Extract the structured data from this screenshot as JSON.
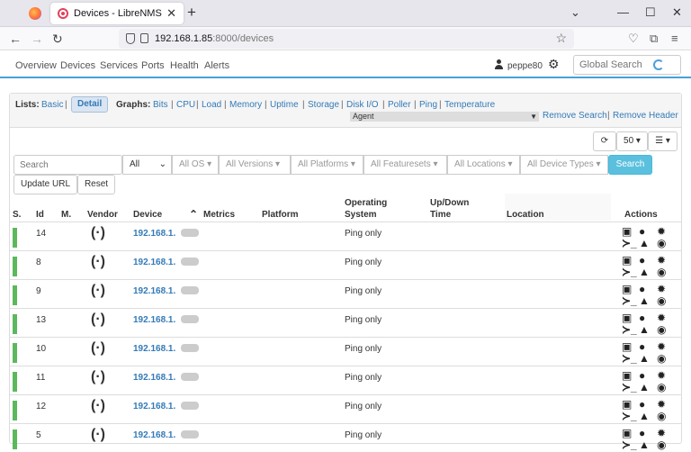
{
  "browser": {
    "tab_title": "Devices - LibreNMS",
    "url_host": "192.168.1.85",
    "url_path": ":8000/devices"
  },
  "nav": {
    "menu": [
      "Overview",
      "Devices",
      "Services",
      "Ports",
      "Health",
      "Alerts"
    ],
    "username": "peppe80",
    "global_search_placeholder": "Global Search"
  },
  "lists": {
    "label": "Lists:",
    "basic": "Basic",
    "detail": "Detail",
    "graphs_label": "Graphs:",
    "graphs": [
      "Bits",
      "CPU",
      "Load",
      "Memory",
      "Uptime",
      "Storage",
      "Disk I/O",
      "Poller",
      "Ping",
      "Temperature"
    ],
    "agent": "Agent",
    "remove_search": "Remove Search",
    "remove_header": "Remove Header"
  },
  "toolbar": {
    "per_page": "50",
    "search_placeholder": "Search",
    "all": "All",
    "filters": [
      "All OS",
      "All Versions",
      "All Platforms",
      "All Featuresets",
      "All Locations",
      "All Device Types"
    ],
    "search_btn": "Search",
    "update_url": "Update URL",
    "reset": "Reset"
  },
  "table": {
    "headers": {
      "s": "S.",
      "id": "Id",
      "m": "M.",
      "vendor": "Vendor",
      "device": "Device",
      "metrics": "Metrics",
      "platform": "Platform",
      "os_line1": "Operating",
      "os_line2": "System",
      "uptime_line1": "Up/Down",
      "uptime_line2": "Time",
      "location": "Location",
      "actions": "Actions"
    },
    "rows": [
      {
        "id": "14",
        "device": "192.168.1.",
        "os": "Ping only"
      },
      {
        "id": "8",
        "device": "192.168.1.",
        "os": "Ping only"
      },
      {
        "id": "9",
        "device": "192.168.1.",
        "os": "Ping only"
      },
      {
        "id": "13",
        "device": "192.168.1.",
        "os": "Ping only"
      },
      {
        "id": "10",
        "device": "192.168.1.",
        "os": "Ping only"
      },
      {
        "id": "11",
        "device": "192.168.1.",
        "os": "Ping only"
      },
      {
        "id": "12",
        "device": "192.168.1.",
        "os": "Ping only"
      },
      {
        "id": "5",
        "device": "192.168.1.",
        "os": "Ping only"
      }
    ]
  },
  "colors": {
    "accent": "#337ab7",
    "status_up": "#5cb85c",
    "search_btn": "#5bc0de"
  }
}
